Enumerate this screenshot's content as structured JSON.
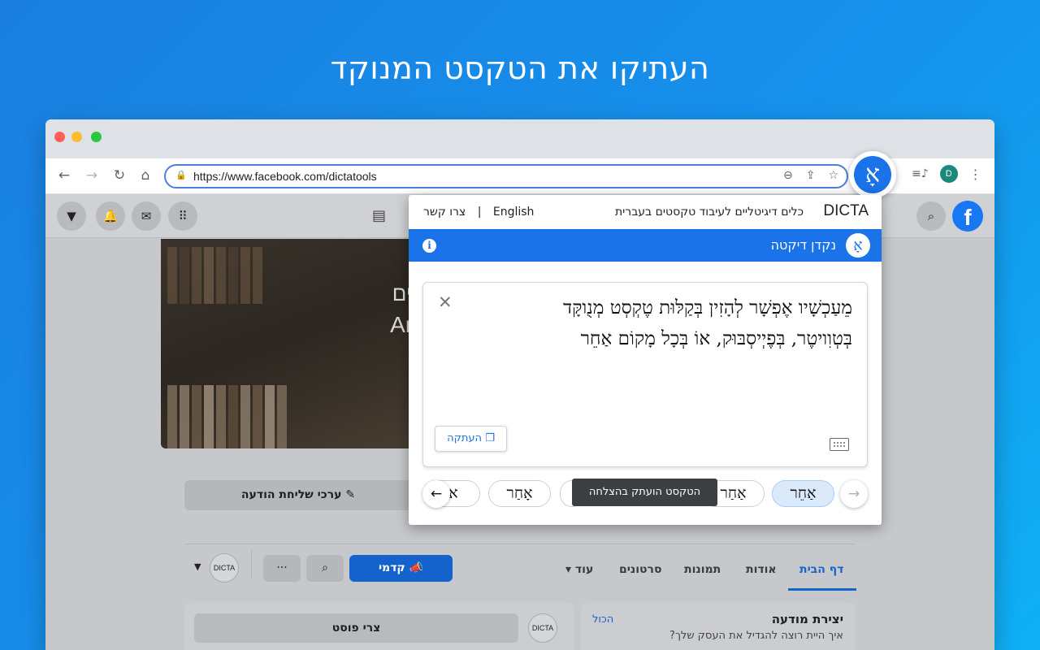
{
  "headline": "העתיקו את הטקסט המנוקד",
  "browser": {
    "url": "https://www.facebook.com/dictatools",
    "profile_initial": "D"
  },
  "facebook": {
    "cover_text_line1": "עבריים",
    "cover_text_line2": "Analyt",
    "edit_send_button": "ערכי שליחת הודעה",
    "tabs": [
      "דף הבית",
      "אודות",
      "תמונות",
      "סרטונים",
      "עוד"
    ],
    "promote_button": "קדמי",
    "page_badge": "DICTA",
    "create_ad_title": "יצירת מודעה",
    "create_ad_sub": "איך היית רוצה להגדיל את העסק שלך?",
    "see_all": "הכול",
    "create_post": "צרי פוסט"
  },
  "dicta_popup": {
    "brand": "DICTA",
    "tagline": "כלים דיגיטליים לעיבוד טקסטים בעברית",
    "lang_link": "English",
    "contact_link": "צרו קשר",
    "tool_title": "נקדן דיקטה",
    "vocalized_text_line1": "מֵעַכְשָׁיו אֶפְשָׁר לְהָזִין בְּקַלּוּת טֶקְסְט מְנֻוקָּד",
    "vocalized_text_line2": "בְּטְוִויטֶר, בְּפֶיְיסְבּוּק, אוֹ בְּכָל מָקוֹם אַחֵר",
    "copy_button": "העתקה",
    "toast": "הטקסט הועתק בהצלחה",
    "options": [
      "אַחֵר",
      "אַחַר",
      "אָחַר",
      "אוֹ"
    ]
  },
  "colors": {
    "accent": "#1a73e8",
    "fb_blue": "#1877f2"
  }
}
